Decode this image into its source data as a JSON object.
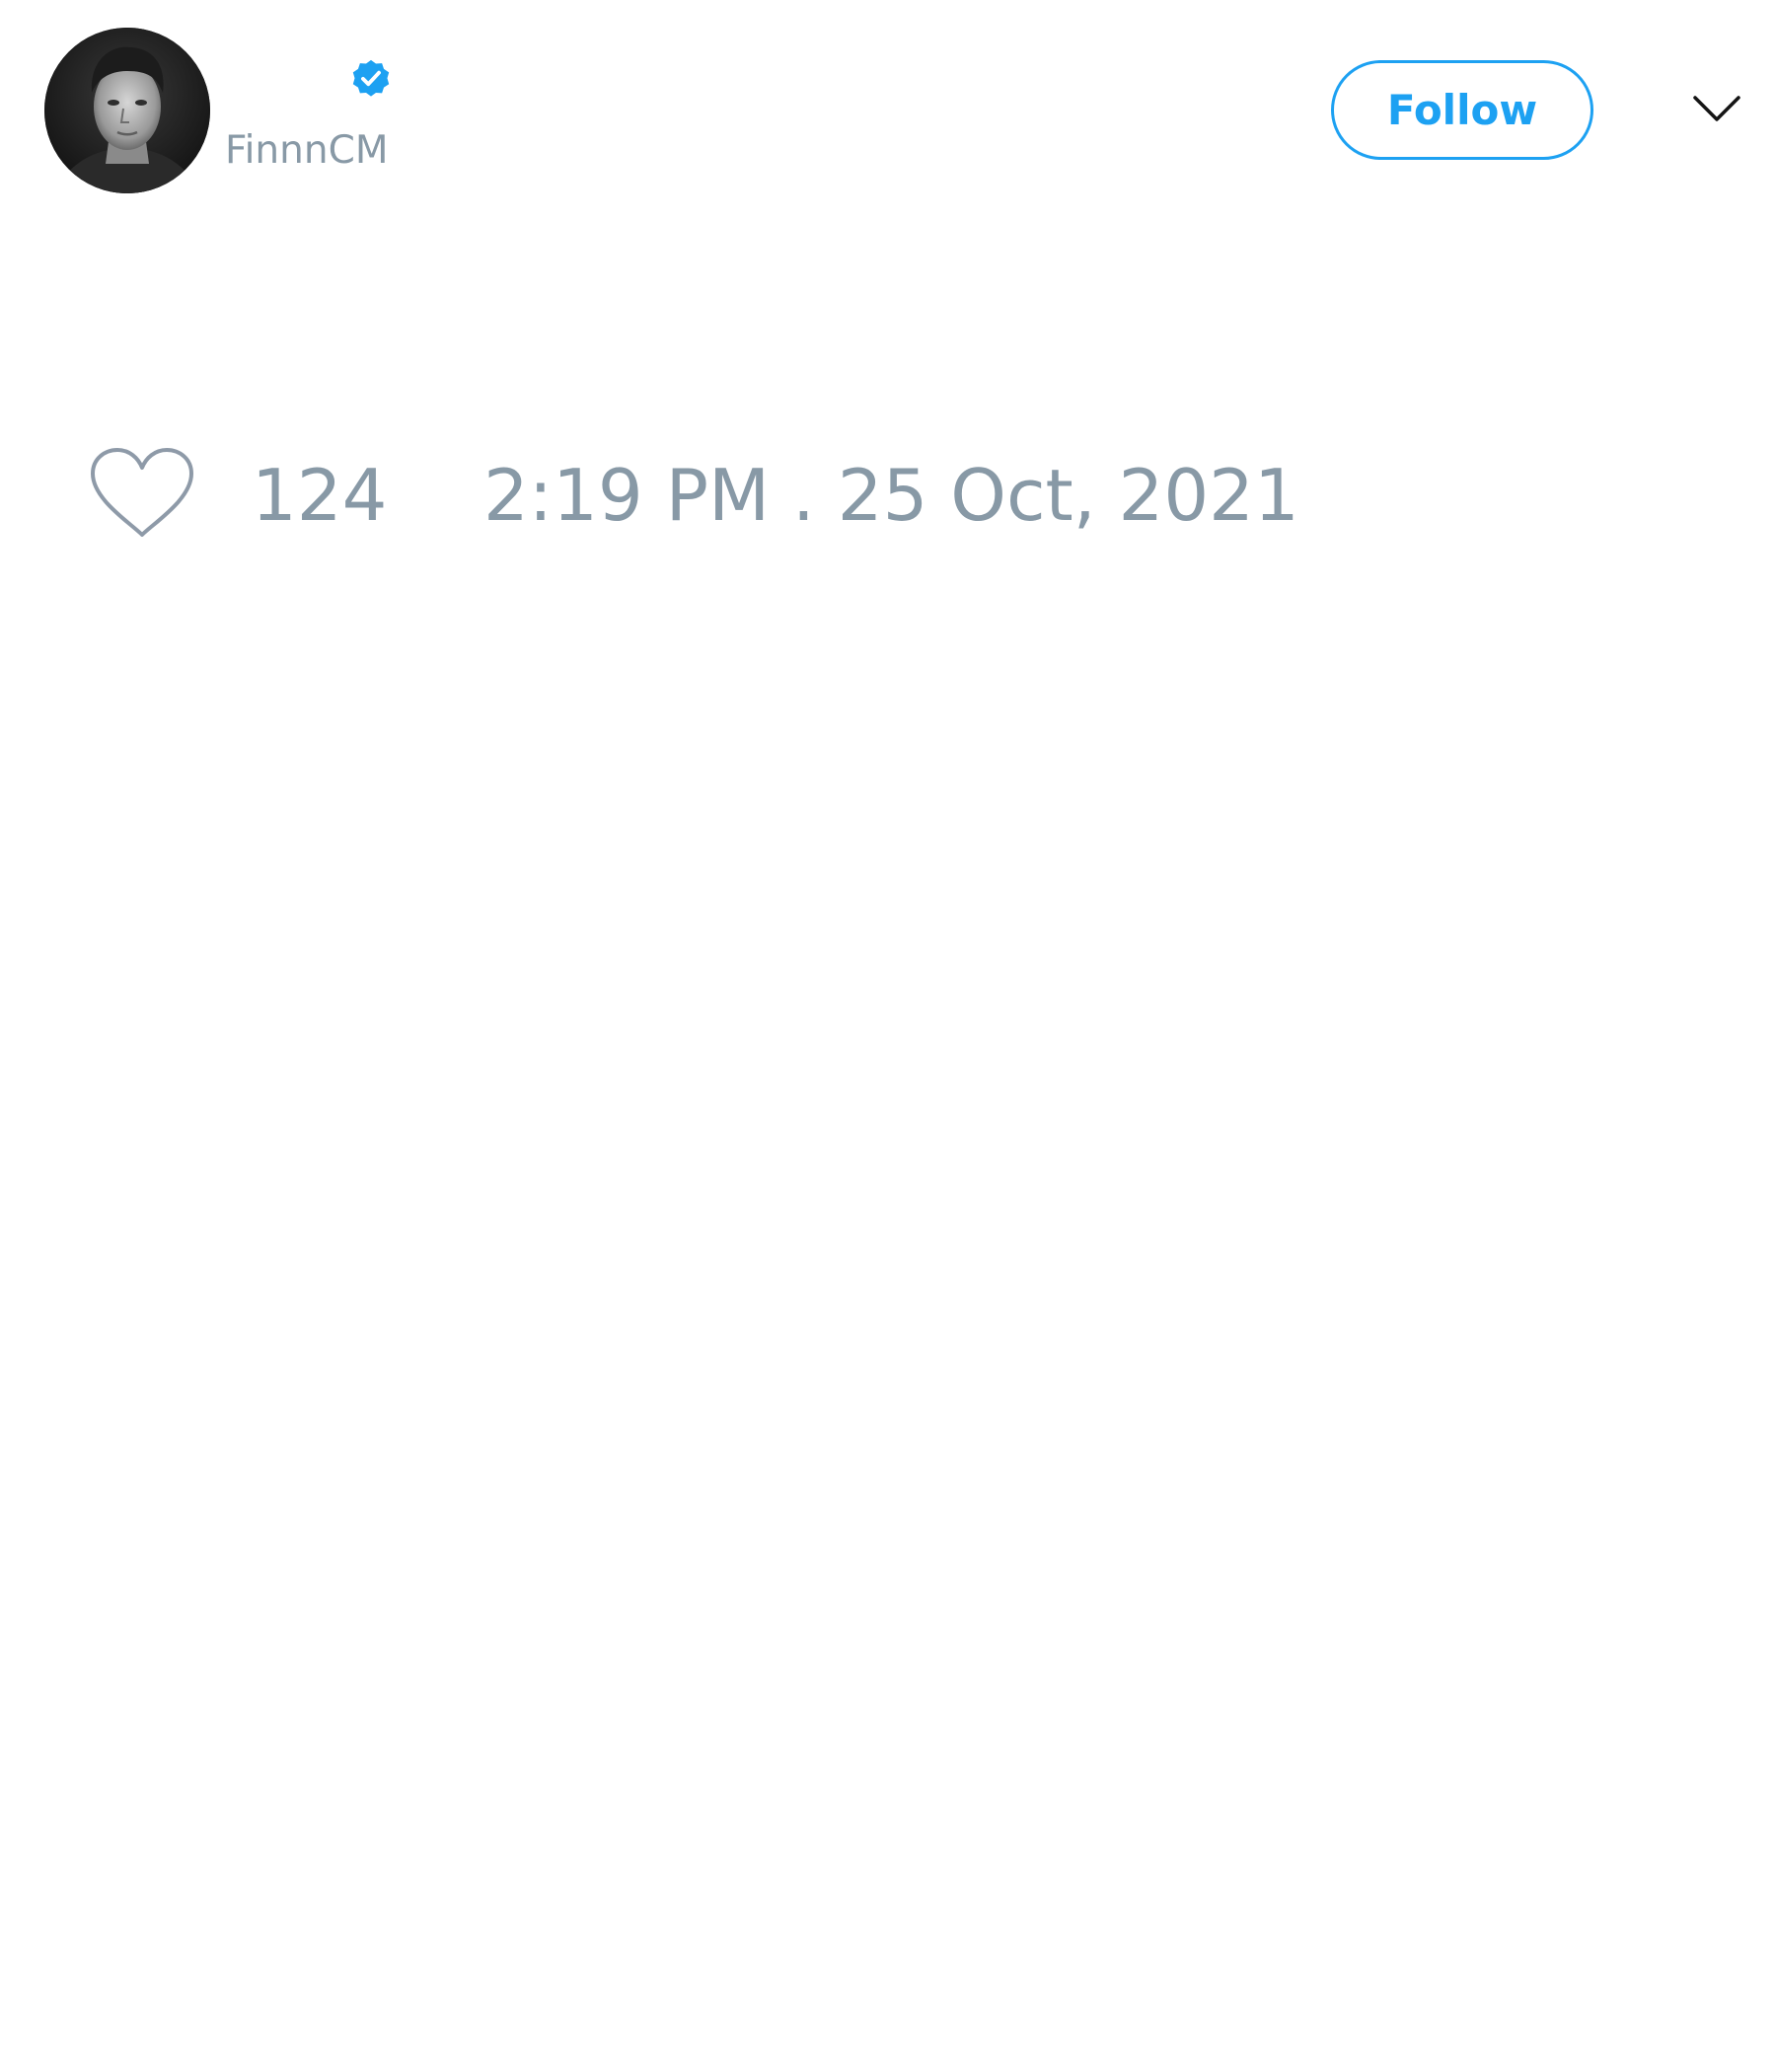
{
  "author": {
    "handle": "FinnnCM",
    "verified": true,
    "avatar": "profile-photo"
  },
  "header": {
    "follow_label": "Follow",
    "menu_icon": "chevron-down-icon"
  },
  "footer": {
    "like_icon": "heart-icon",
    "like_count": "124",
    "timestamp": "2:19 PM . 25 Oct, 2021"
  },
  "colors": {
    "accent": "#1da1f2",
    "muted_text": "#8899a6",
    "background": "#ffffff"
  }
}
